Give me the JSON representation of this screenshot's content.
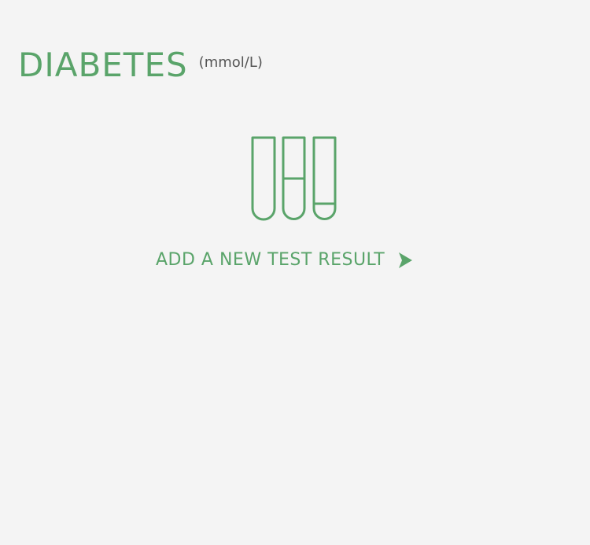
{
  "header": {
    "title": "DIABETES",
    "unit": "(mmol/L)"
  },
  "empty_state": {
    "icon": "test-tubes-icon",
    "action_label": "ADD A NEW TEST RESULT",
    "action_icon": "play-arrow-icon"
  },
  "colors": {
    "accent": "#5aa46a",
    "background": "#f4f4f4",
    "unit_text": "#555555"
  }
}
